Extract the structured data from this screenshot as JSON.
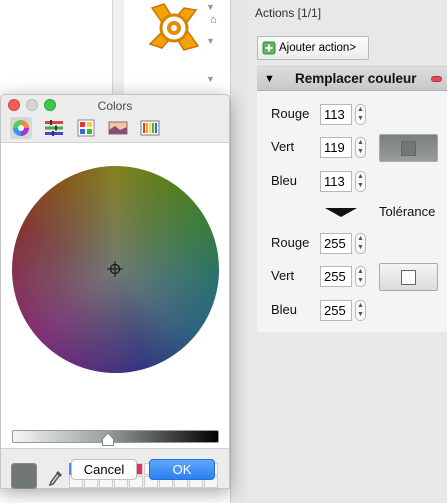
{
  "actions_panel": {
    "title": "Actions [1/1]",
    "add_action_label": "Ajouter action>",
    "card": {
      "title": "Remplacer couleur",
      "fields": [
        {
          "label": "Rouge",
          "value": "113"
        },
        {
          "label": "Vert",
          "value": "119"
        },
        {
          "label": "Bleu",
          "value": "113"
        }
      ],
      "tolerance_label": "Tolérance",
      "tolerance_fields": [
        {
          "label": "Rouge",
          "value": "255"
        },
        {
          "label": "Vert",
          "value": "255"
        },
        {
          "label": "Bleu",
          "value": "255"
        }
      ],
      "colors": {
        "source_swatch": "#717773",
        "tolerance_swatch": "#ffffff"
      }
    }
  },
  "colors_window": {
    "title": "Colors",
    "modes": [
      "color-wheel-icon",
      "sliders-icon",
      "palettes-icon",
      "image-palettes-icon",
      "pencils-icon"
    ],
    "current_color": "#717773",
    "palette": [
      "#717773",
      "#1f5f5f",
      "#58d0ee",
      "#e03a6a",
      "#d8345c"
    ],
    "cancel_label": "Cancel",
    "ok_label": "OK"
  }
}
